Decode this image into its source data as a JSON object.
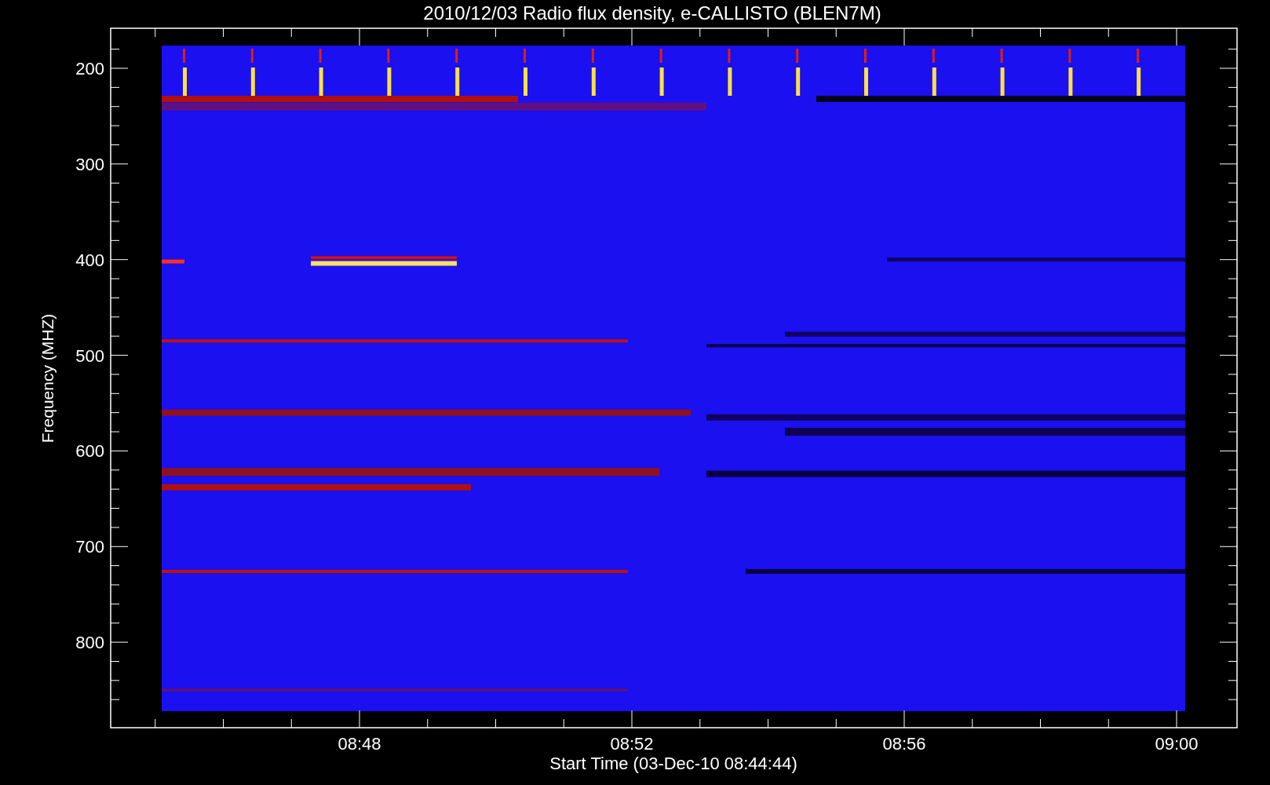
{
  "title": "2010/12/03  Radio flux density, e-CALLISTO (BLEN7M)",
  "y_axis": {
    "label": "Frequency (MHZ)",
    "ticks": [
      "200",
      "300",
      "400",
      "500",
      "600",
      "700",
      "800"
    ]
  },
  "x_axis": {
    "label": "Start Time (03-Dec-10 08:44:44)",
    "ticks": [
      "08:48",
      "08:52",
      "08:56",
      "09:00"
    ]
  }
}
